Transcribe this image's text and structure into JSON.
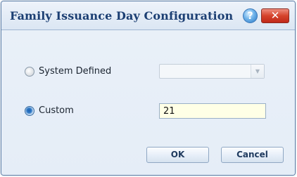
{
  "dialog": {
    "title": "Family Issuance Day Configuration",
    "help_icon": "help-icon",
    "help_glyph": "?",
    "close_icon": "close-icon",
    "close_glyph": "✕"
  },
  "options": {
    "system_defined": {
      "label": "System Defined",
      "checked": false,
      "select_value": "",
      "dropdown_glyph": "▼"
    },
    "custom": {
      "label": "Custom",
      "checked": true,
      "value": "21"
    }
  },
  "buttons": {
    "ok_label": "OK",
    "cancel_label": "Cancel"
  },
  "colors": {
    "title_text": "#1c3f73",
    "close_button": "#d5432c",
    "input_background": "#ffffe6",
    "dialog_background": "#e6eef7"
  }
}
